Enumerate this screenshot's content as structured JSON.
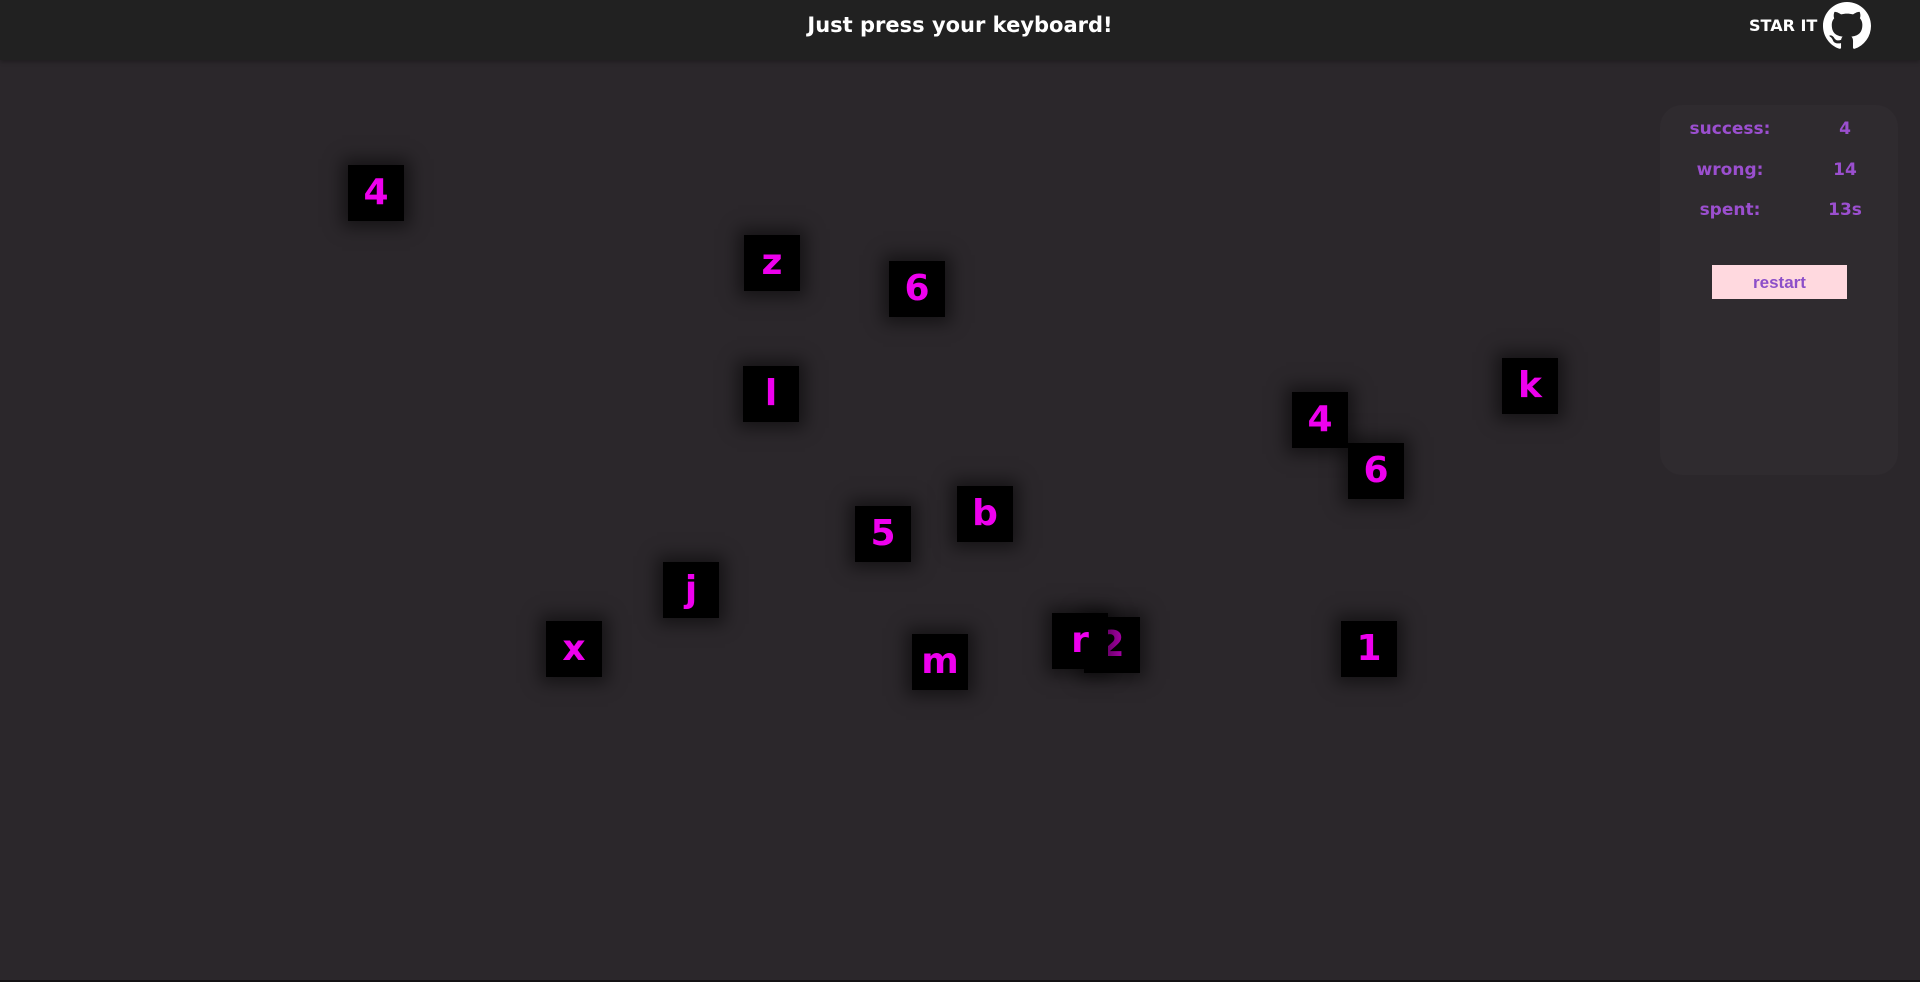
{
  "header": {
    "title": "Just press your keyboard!",
    "star_label": "STAR IT",
    "github_icon": "github-octocat-icon"
  },
  "stats": {
    "success_label": "success:",
    "success_value": "4",
    "wrong_label": "wrong:",
    "wrong_value": "14",
    "spent_label": "spent:",
    "spent_value": "13s",
    "restart_label": "restart"
  },
  "colors": {
    "page_bg": "#2b272b",
    "header_bg": "#212121",
    "tile_bg": "#000000",
    "tile_text": "#ee00ee",
    "stats_text": "#9b4fcf",
    "restart_bg": "#ffd9df"
  },
  "tiles": [
    "4",
    "z",
    "6",
    "l",
    "4",
    "k",
    "6",
    "5",
    "b",
    "j",
    "x",
    "m",
    "r",
    "2",
    "1"
  ]
}
